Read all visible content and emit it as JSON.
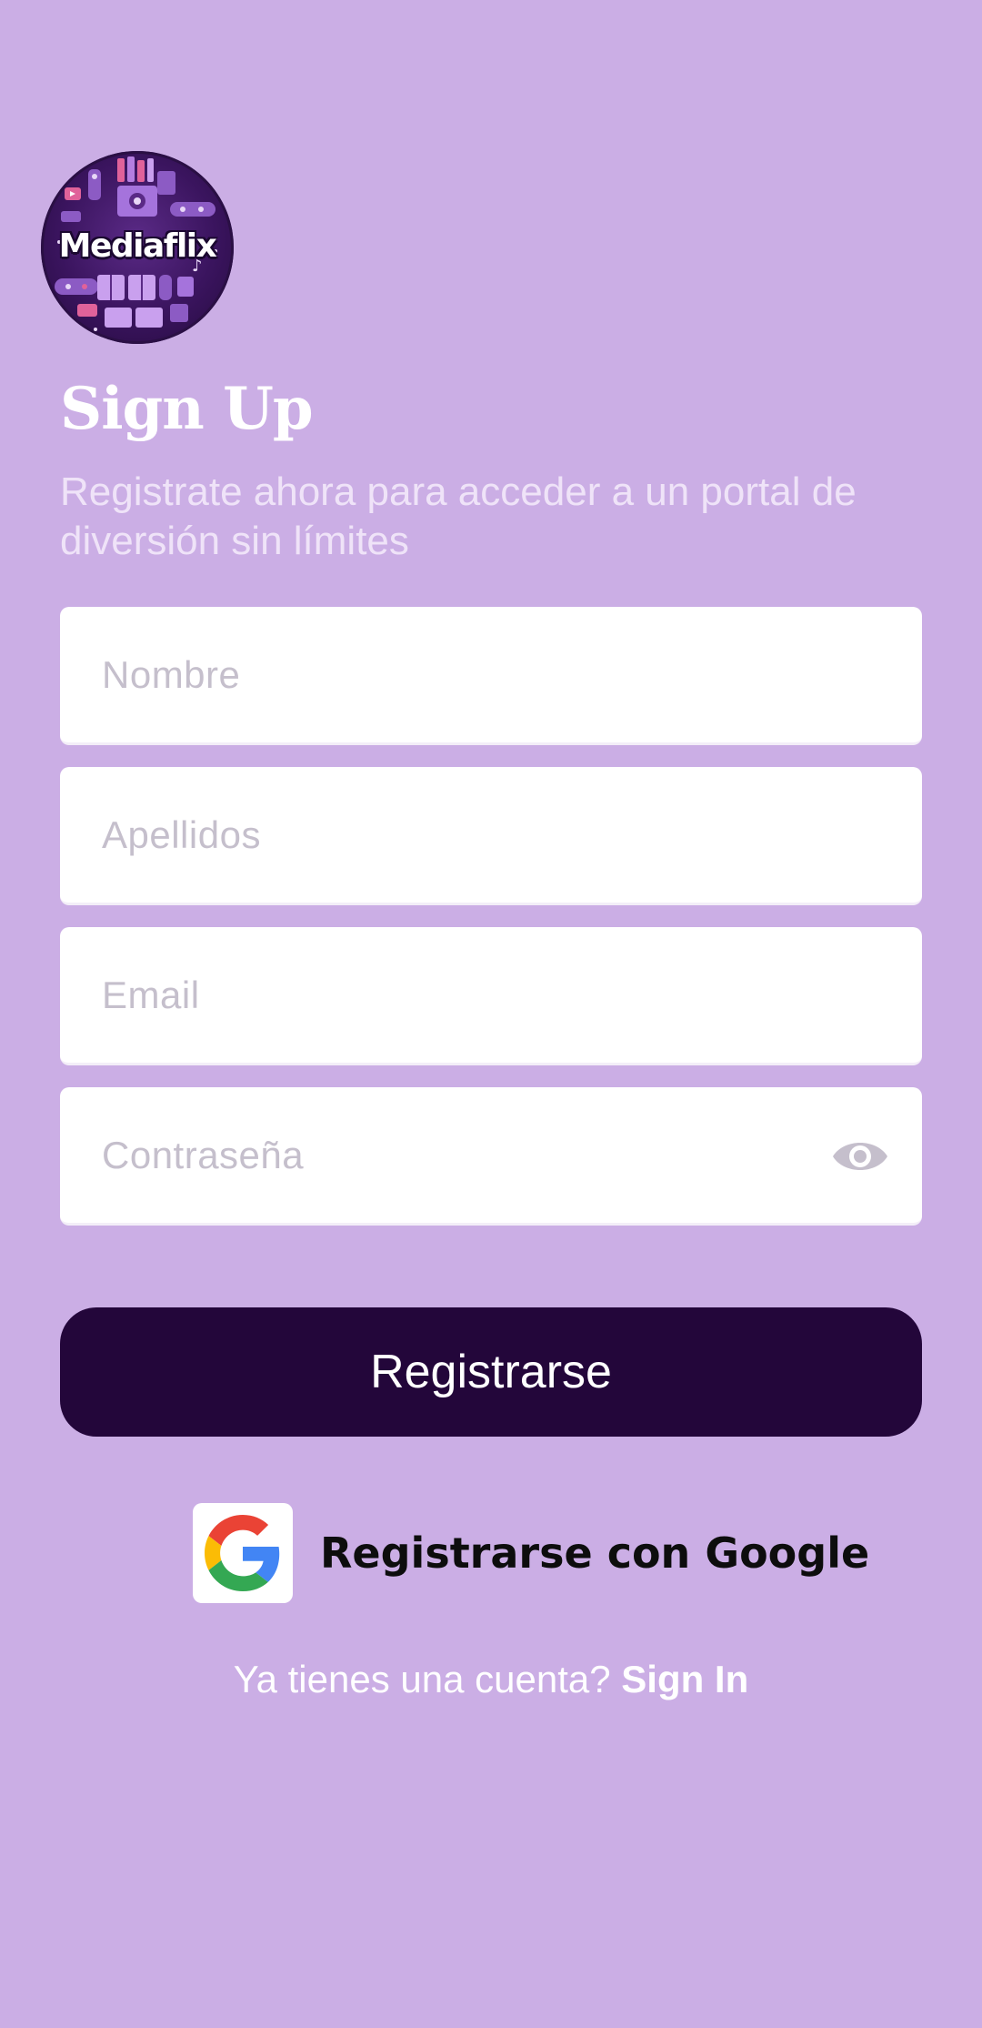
{
  "logo": {
    "text": "Mediaflix",
    "icon": "mediaflix-logo"
  },
  "header": {
    "title": "Sign Up",
    "subtitle": "Registrate ahora para acceder a un portal de diversión sin límites"
  },
  "form": {
    "nombre_placeholder": "Nombre",
    "apellidos_placeholder": "Apellidos",
    "email_placeholder": "Email",
    "password_placeholder": "Contraseña",
    "password_toggle_icon": "eye-icon"
  },
  "actions": {
    "register_label": "Registrarse",
    "google_label": "Registrarse con Google",
    "google_icon": "google-g-icon"
  },
  "footer": {
    "prompt": "Ya tienes una cuenta?",
    "signin_label": "Sign In"
  },
  "colors": {
    "background": "#cbaee5",
    "primary_button": "#23063a",
    "field_background": "#ffffff",
    "placeholder": "#c5bfcc"
  }
}
